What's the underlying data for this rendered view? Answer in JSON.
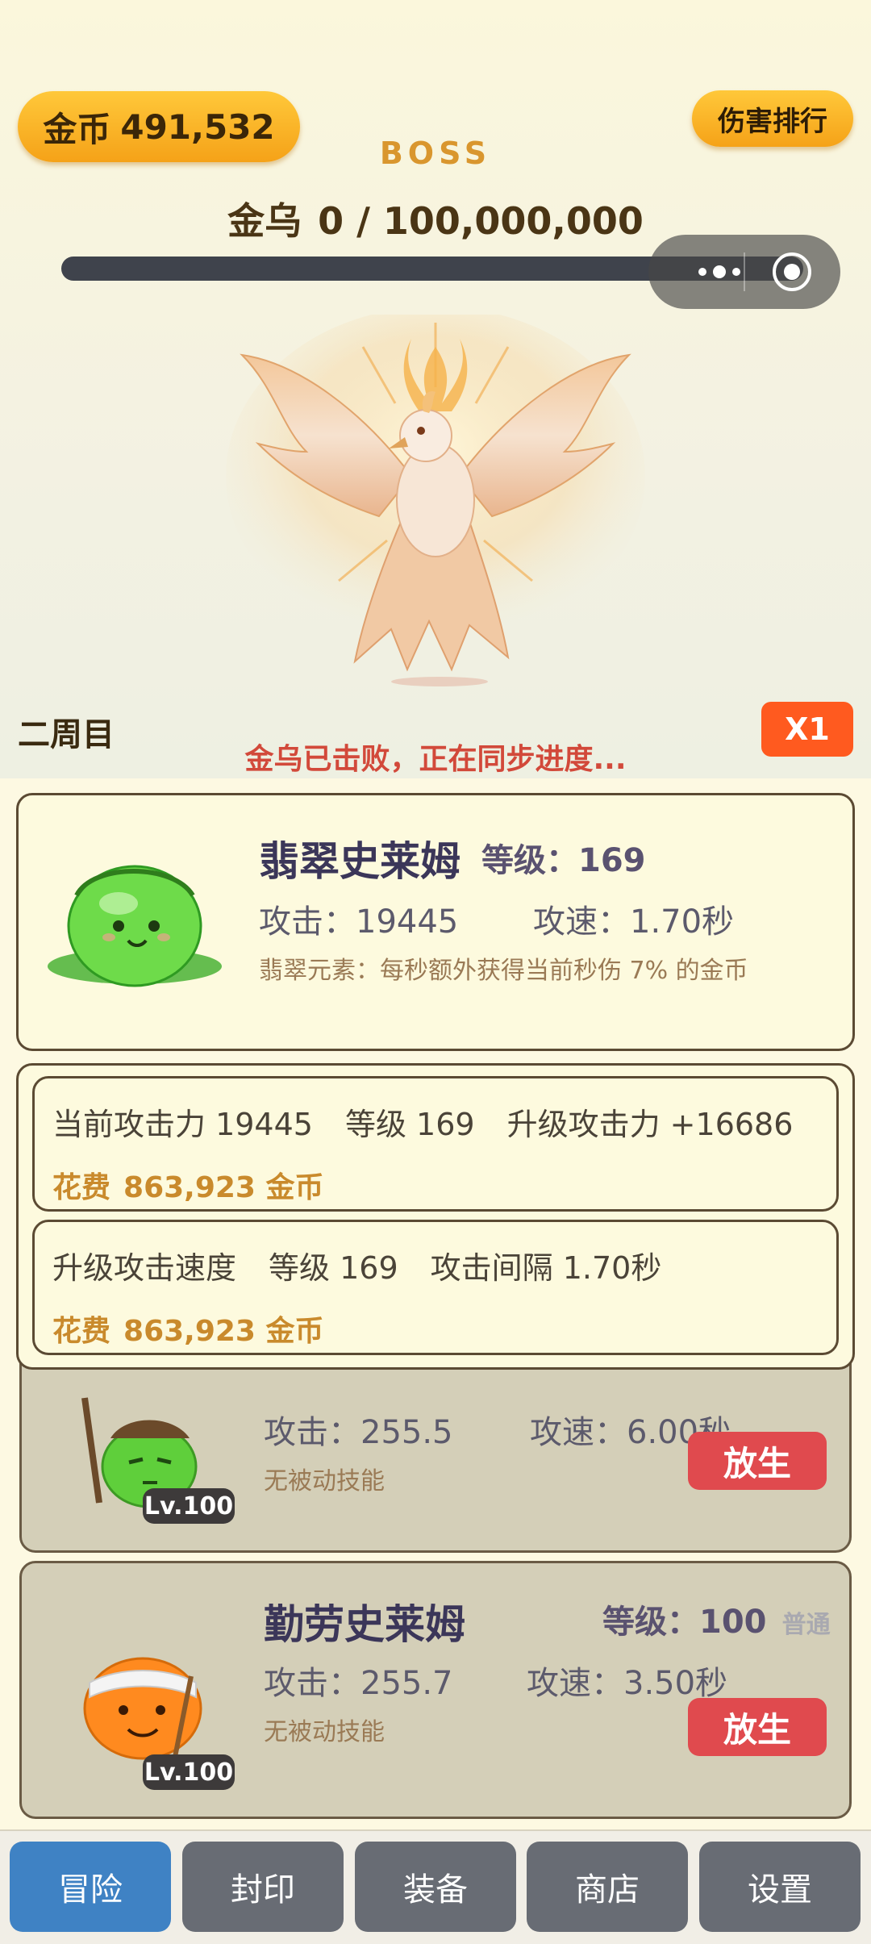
{
  "header": {
    "coin_label": "金币",
    "coin_value": "491,532",
    "rank_button": "伤害排行",
    "boss_tag": "BOSS",
    "boss_name": "金乌",
    "boss_hp": "0 / 100,000,000",
    "hp_fraction": 0
  },
  "status": {
    "round": "二周目",
    "speed": "X1",
    "message": "金乌已击败，正在同步进度..."
  },
  "active_slime": {
    "name": "翡翠史莱姆",
    "level_label": "等级：",
    "level": "169",
    "attack": "攻击：19445",
    "speed": "攻速：1.70秒",
    "skill": "翡翠元素：每秒额外获得当前秒伤 7% 的金币"
  },
  "upgrades": [
    {
      "items": [
        "当前攻击力 19445",
        "等级 169",
        "升级攻击力 +16686"
      ],
      "cost_label": "花费",
      "cost_value": "863,923 金币"
    },
    {
      "items": [
        "升级攻击速度",
        "等级 169",
        "攻击间隔 1.70秒"
      ],
      "cost_label": "花费",
      "cost_value": "863,923 金币"
    }
  ],
  "slimes": [
    {
      "attack": "攻击：255.5",
      "speed": "攻速：6.00秒",
      "skill": "无被动技能",
      "badge": "Lv.100",
      "release": "放生"
    },
    {
      "name": "勤劳史莱姆",
      "level_label": "等级：",
      "level": "100",
      "rarity": "普通",
      "attack": "攻击：255.7",
      "speed": "攻速：3.50秒",
      "skill": "无被动技能",
      "badge": "Lv.100",
      "release": "放生"
    }
  ],
  "nav": [
    "冒险",
    "封印",
    "装备",
    "商店",
    "设置"
  ],
  "colors": {
    "accent": "#f5a218",
    "alert": "#d2493a",
    "nav_active": "#3f82c4",
    "release": "#e04a4e"
  }
}
